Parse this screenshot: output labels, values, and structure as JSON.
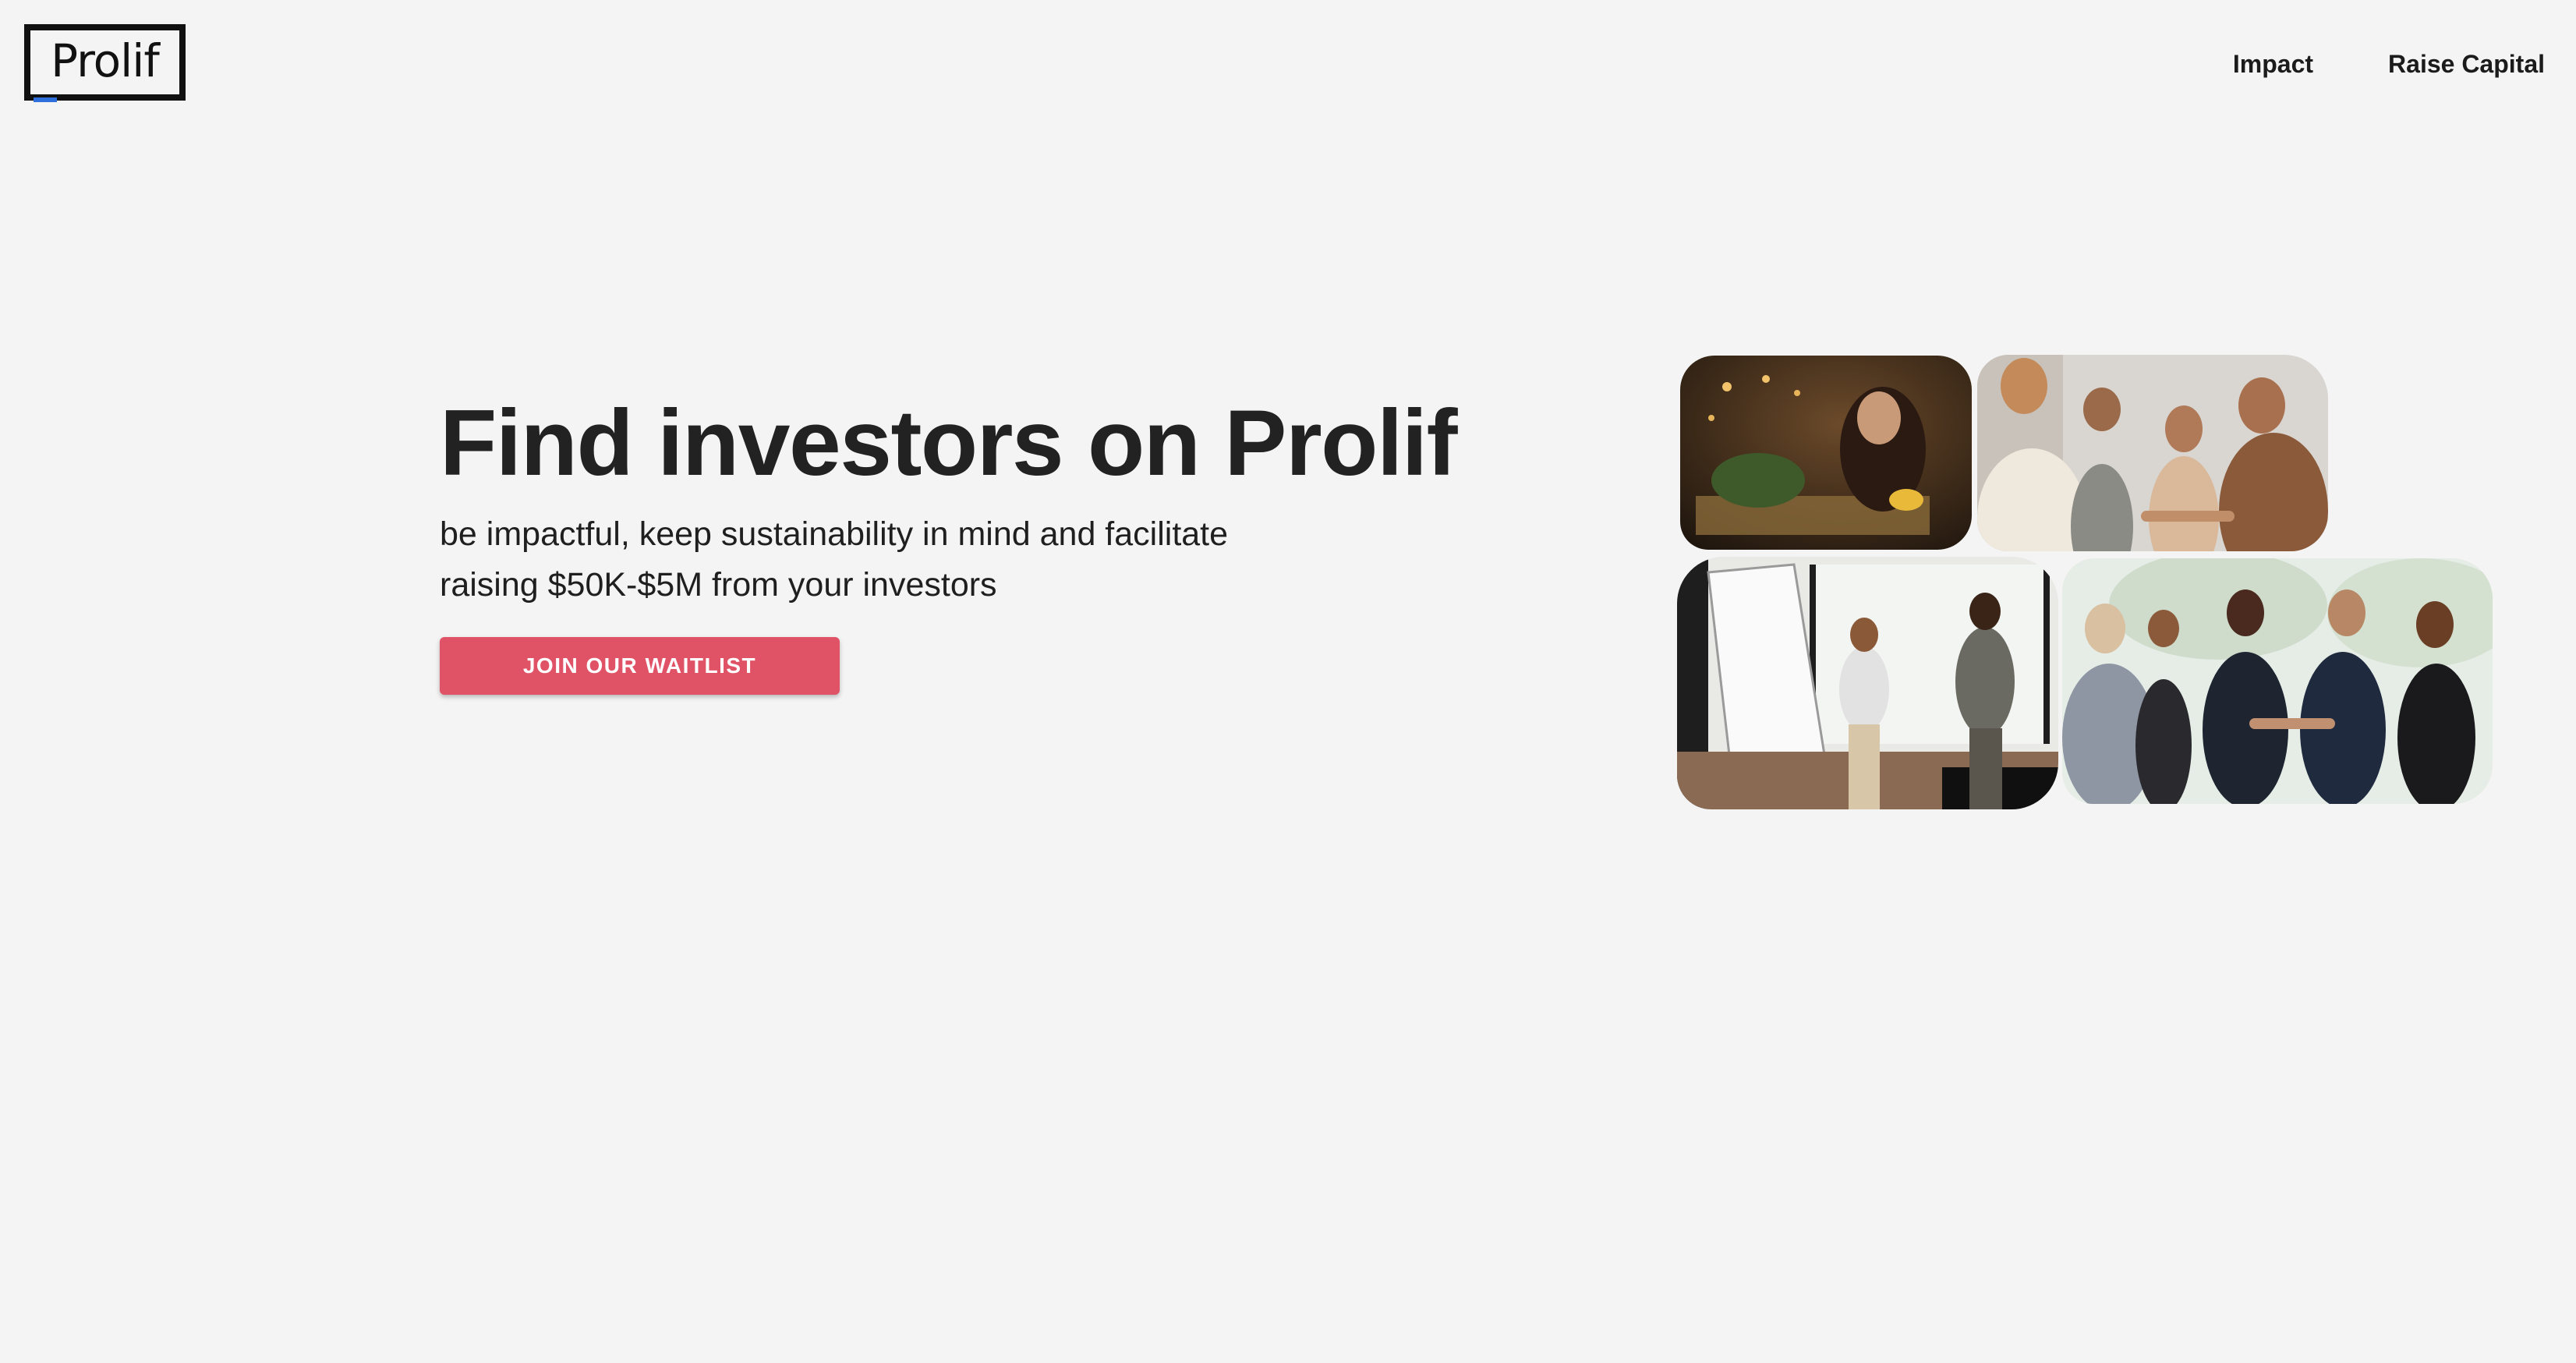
{
  "header": {
    "logo_text": "Prolif",
    "nav": [
      {
        "label": "Impact"
      },
      {
        "label": "Raise Capital"
      }
    ]
  },
  "hero": {
    "title": "Find investors on Prolif",
    "subtitle": "be impactful, keep sustainability in mind and facilitate raising $50K-$5M from your investors",
    "cta_label": "JOIN OUR WAITLIST"
  },
  "colors": {
    "background": "#f4f4f4",
    "cta": "#e05266",
    "text": "#222222",
    "logo_accent": "#2f6fdc"
  }
}
